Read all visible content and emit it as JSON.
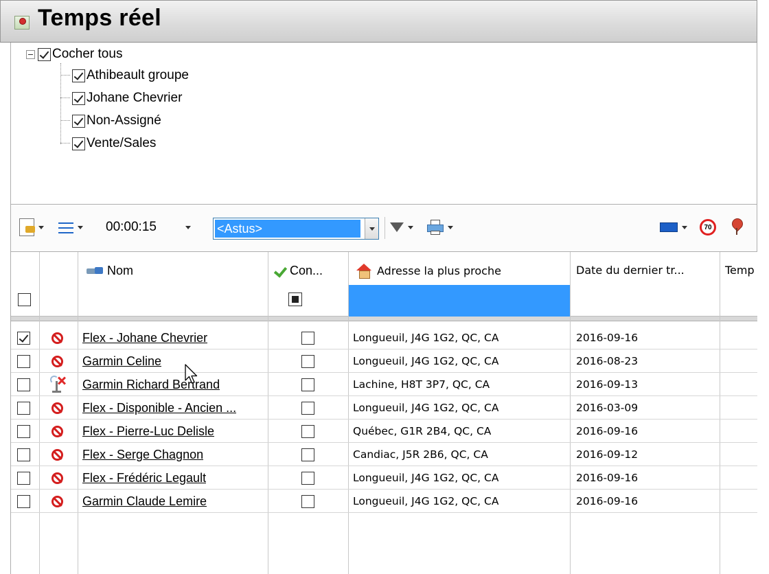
{
  "window": {
    "title": "Temps réel"
  },
  "tree": {
    "root_label": "Cocher tous",
    "items": [
      {
        "label": "Athibeault groupe",
        "checked": true
      },
      {
        "label": "Johane Chevrier",
        "checked": true
      },
      {
        "label": "Non-Assigné",
        "checked": true
      },
      {
        "label": "Vente/Sales",
        "checked": true
      }
    ]
  },
  "toolbar": {
    "refresh_interval": "00:00:15",
    "group_selector": "<Astus>",
    "icons": [
      "document-icon",
      "list-icon",
      "filter-icon",
      "printer-icon",
      "color-swatch-icon",
      "speed-limit-icon",
      "map-pin-icon"
    ],
    "speed_limit": "70",
    "accent_color": "#3399ff"
  },
  "grid": {
    "columns": [
      {
        "key": "select",
        "label": ""
      },
      {
        "key": "status",
        "label": ""
      },
      {
        "key": "name",
        "label": "Nom"
      },
      {
        "key": "connected",
        "label": "Con..."
      },
      {
        "key": "address",
        "label": "Adresse la plus proche"
      },
      {
        "key": "last_date",
        "label": "Date du dernier tr..."
      },
      {
        "key": "time",
        "label": "Temp"
      }
    ],
    "rows": [
      {
        "selected": true,
        "status": "stop-icon",
        "name": "Flex - Johane Chevrier",
        "address": "Longueuil, J4G 1G2, QC, CA",
        "date": "2016-09-16"
      },
      {
        "selected": false,
        "status": "stop-icon",
        "name": "Garmin Celine",
        "address": "Longueuil, J4G 1G2, QC, CA",
        "date": "2016-08-23"
      },
      {
        "selected": false,
        "status": "no-signal-icon",
        "name": "Garmin Richard Bertrand",
        "address": "Lachine, H8T 3P7, QC, CA",
        "date": "2016-09-13"
      },
      {
        "selected": false,
        "status": "stop-icon",
        "name": "Flex - Disponible - Ancien ...",
        "address": "Longueuil, J4G 1G2, QC, CA",
        "date": "2016-03-09"
      },
      {
        "selected": false,
        "status": "stop-icon",
        "name": "Flex - Pierre-Luc Delisle",
        "address": "Québec, G1R 2B4, QC, CA",
        "date": "2016-09-16"
      },
      {
        "selected": false,
        "status": "stop-icon",
        "name": "Flex - Serge Chagnon",
        "address": "Candiac, J5R 2B6, QC, CA",
        "date": "2016-09-12"
      },
      {
        "selected": false,
        "status": "stop-icon",
        "name": "Flex - Frédéric Legault",
        "address": "Longueuil, J4G 1G2, QC, CA",
        "date": "2016-09-16"
      },
      {
        "selected": false,
        "status": "stop-icon",
        "name": "Garmin Claude Lemire",
        "address": "Longueuil, J4G 1G2, QC, CA",
        "date": "2016-09-16"
      }
    ]
  }
}
